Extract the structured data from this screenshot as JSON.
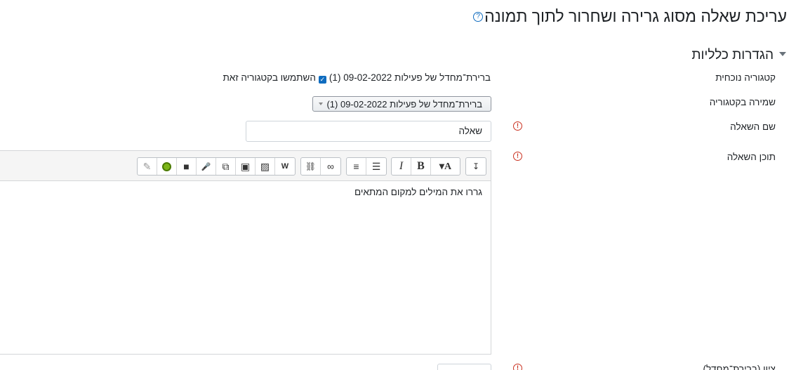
{
  "page": {
    "title": "עריכת שאלה מסוג גרירה ושחרור לתוך תמונה",
    "help_glyph": "?"
  },
  "section": {
    "title": "הגדרות כלליות"
  },
  "fields": {
    "current_category": {
      "label": "קטגוריה נוכחית",
      "value": "ברירת־מחדל של פעילות 09-02-2022 (1)",
      "checkbox_label": "השתמשו בקטגוריה זאת",
      "checked": true
    },
    "save_category": {
      "label": "שמירה בקטגוריה",
      "selected": "ברירת־מחדל של פעילות 09-02-2022 (1)"
    },
    "question_name": {
      "label": "שם השאלה",
      "value": "שאלה"
    },
    "question_text": {
      "label": "תוכן השאלה",
      "value": "גררו את  המילים למקום המתאים"
    },
    "next_field": {
      "label": "ציון (ברירת־מחדל)"
    }
  },
  "required_glyph": "!",
  "toolbar": {
    "groups": [
      {
        "buttons": [
          {
            "name": "edit-pencil-icon",
            "glyph": "✎"
          },
          {
            "name": "emoji-icon",
            "glyph": "☺"
          },
          {
            "name": "video-record-icon",
            "glyph": "■"
          },
          {
            "name": "audio-record-icon",
            "glyph": "🎤"
          },
          {
            "name": "manage-files-icon",
            "glyph": "⧉"
          },
          {
            "name": "media-icon",
            "glyph": "▣"
          },
          {
            "name": "image-icon",
            "glyph": "▨"
          },
          {
            "name": "word-paste-icon",
            "glyph": "W"
          }
        ]
      },
      {
        "buttons": [
          {
            "name": "unlink-icon",
            "glyph": "⛓"
          },
          {
            "name": "link-icon",
            "glyph": "∞"
          }
        ]
      },
      {
        "buttons": [
          {
            "name": "ordered-list-icon",
            "glyph": "≡"
          },
          {
            "name": "unordered-list-icon",
            "glyph": "☰"
          }
        ]
      },
      {
        "buttons": [
          {
            "name": "italic-icon",
            "glyph": "I"
          },
          {
            "name": "bold-icon",
            "glyph": "B"
          },
          {
            "name": "font-style-icon",
            "glyph": "▾A"
          }
        ]
      },
      {
        "buttons": [
          {
            "name": "toolbar-toggle-icon",
            "glyph": "↧"
          }
        ]
      }
    ]
  },
  "colors": {
    "accent": "#0f6cbf",
    "required": "#ca3120"
  }
}
